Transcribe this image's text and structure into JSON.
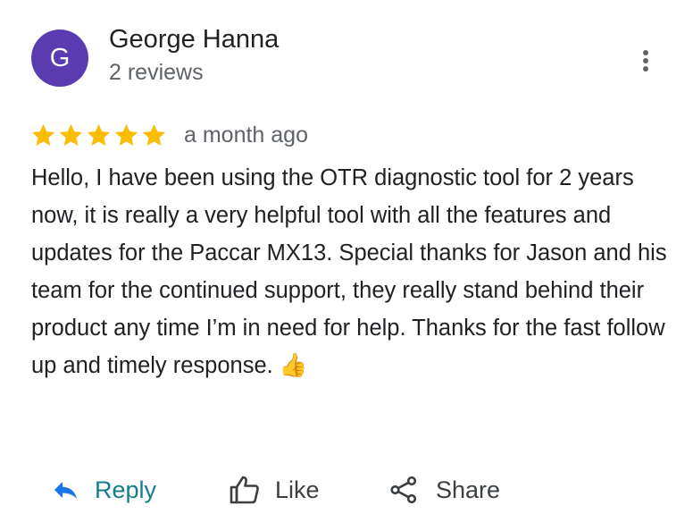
{
  "reviewer": {
    "avatar_initial": "G",
    "name": "George Hanna",
    "meta": "2 reviews"
  },
  "review": {
    "rating": 5,
    "rating_max": 5,
    "time": "a month ago",
    "text": "Hello, I have been using the OTR diagnostic tool for 2 years now, it is really a very helpful tool with all the features and updates for the Paccar MX13. Special thanks for Jason and his team for the continued support, they really stand behind their product any time I’m in need for help. Thanks for the fast follow up and timely response. 👍"
  },
  "actions": {
    "reply_label": "Reply",
    "like_label": "Like",
    "share_label": "Share"
  },
  "colors": {
    "avatar_bg": "#5b3cb0",
    "star": "#fbbc04",
    "reply_icon": "#1a73e8",
    "reply_text": "#137e8a"
  },
  "icons": {
    "more": "more-vertical-icon",
    "star": "star-icon",
    "reply": "reply-arrow-icon",
    "like": "thumbs-up-icon",
    "share": "share-icon"
  }
}
